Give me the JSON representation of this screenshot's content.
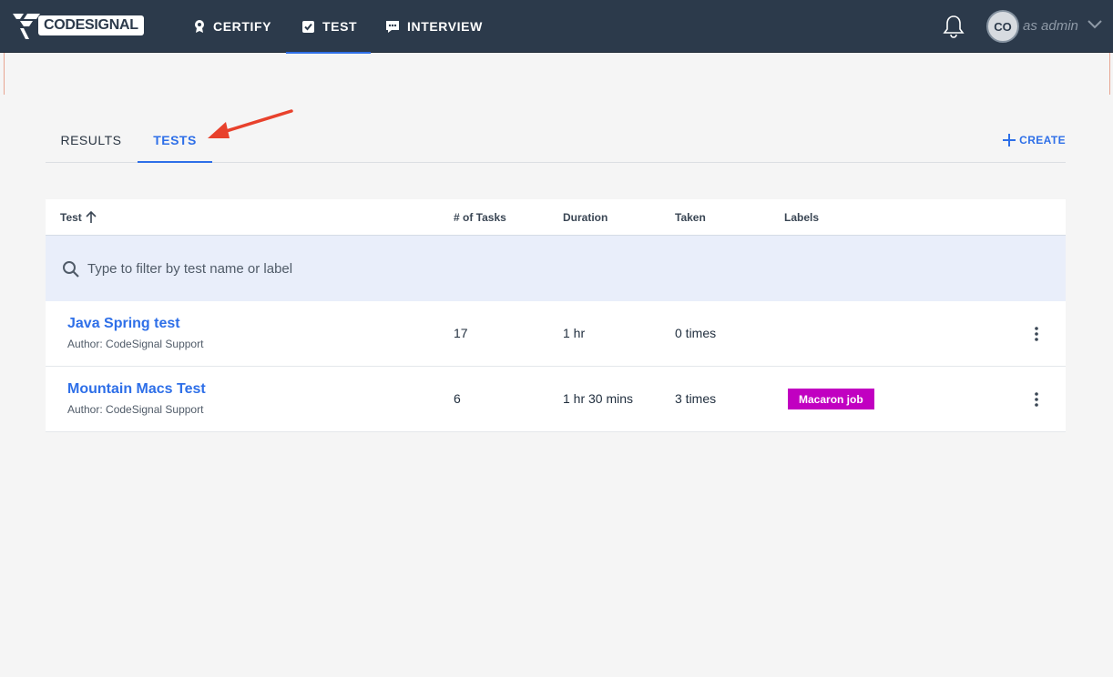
{
  "nav": {
    "logo_text": "CODESIGNAL",
    "items": [
      {
        "label": "CERTIFY",
        "icon": "badge-icon"
      },
      {
        "label": "TEST",
        "icon": "checkbox-icon"
      },
      {
        "label": "INTERVIEW",
        "icon": "chat-icon"
      }
    ],
    "avatar_initials": "CO",
    "role_text": "as admin"
  },
  "tabs": [
    {
      "label": "RESULTS",
      "active": false
    },
    {
      "label": "TESTS",
      "active": true
    }
  ],
  "create_label": "CREATE",
  "table": {
    "columns": [
      "Test",
      "# of Tasks",
      "Duration",
      "Taken",
      "Labels"
    ],
    "sort_column": "Test",
    "sort_direction": "ascending",
    "filter_placeholder": "Type to filter by test name or label",
    "rows": [
      {
        "name": "Java Spring test",
        "author": "Author: CodeSignal Support",
        "tasks": "17",
        "duration": "1 hr",
        "taken": "0 times",
        "label": ""
      },
      {
        "name": "Mountain Macs Test",
        "author": "Author: CodeSignal Support",
        "tasks": "6",
        "duration": "1 hr 30 mins",
        "taken": "3 times",
        "label": "Macaron job"
      }
    ]
  },
  "colors": {
    "nav_bg": "#2c3a4b",
    "accent": "#2e6fe8",
    "label_chip": "#c100c1",
    "annotation_arrow": "#e8412c"
  }
}
